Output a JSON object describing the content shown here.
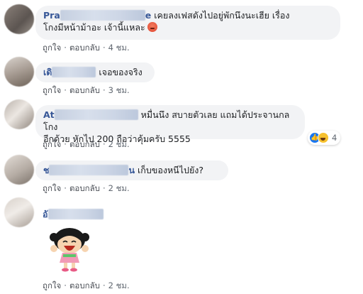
{
  "comments": [
    {
      "author_visible": "Pra",
      "author_tail": "e",
      "text_line1": "เคยลงเฟสดังไปอยู่พักนึงนะเฮีย เรื่อง",
      "text_line2": "โกงมีหน้าม้าอะ เจ้านี้แหละ",
      "emoji": "angry-face-icon",
      "like": "ถูกใจ",
      "reply": "ตอบกลับ",
      "time": "4 ชม."
    },
    {
      "author_visible": "เดิ",
      "text_line1": "เจอของจริง",
      "like": "ถูกใจ",
      "reply": "ตอบกลับ",
      "time": "3 ชม."
    },
    {
      "author_visible": "At",
      "text_line1": "หมื่นนึง สบายตัวเลย แถมได้ประจานกลโกง",
      "text_line2": "อีกด้วย หักไป 200 ถือว่าคุ้มครับ 5555",
      "reactions": {
        "icons": [
          "like-icon",
          "haha-icon"
        ],
        "count": "4"
      },
      "like": "ถูกใจ",
      "reply": "ตอบกลับ",
      "time": "2 ชม."
    },
    {
      "author_visible": "ช",
      "author_tail": "น",
      "text_line1": "เก็บของหนีไปยัง?",
      "like": "ถูกใจ",
      "reply": "ตอบกลับ",
      "time": "2 ชม."
    },
    {
      "author_visible": "อั",
      "sticker": "laughing-girl-sticker",
      "like": "ถูกใจ",
      "reply": "ตอบกลับ",
      "time": "2 ชม."
    }
  ],
  "colors": {
    "bubble": "#f2f3f5",
    "author": "#385898",
    "meta": "#606770",
    "like_blue": "#1877f2"
  }
}
